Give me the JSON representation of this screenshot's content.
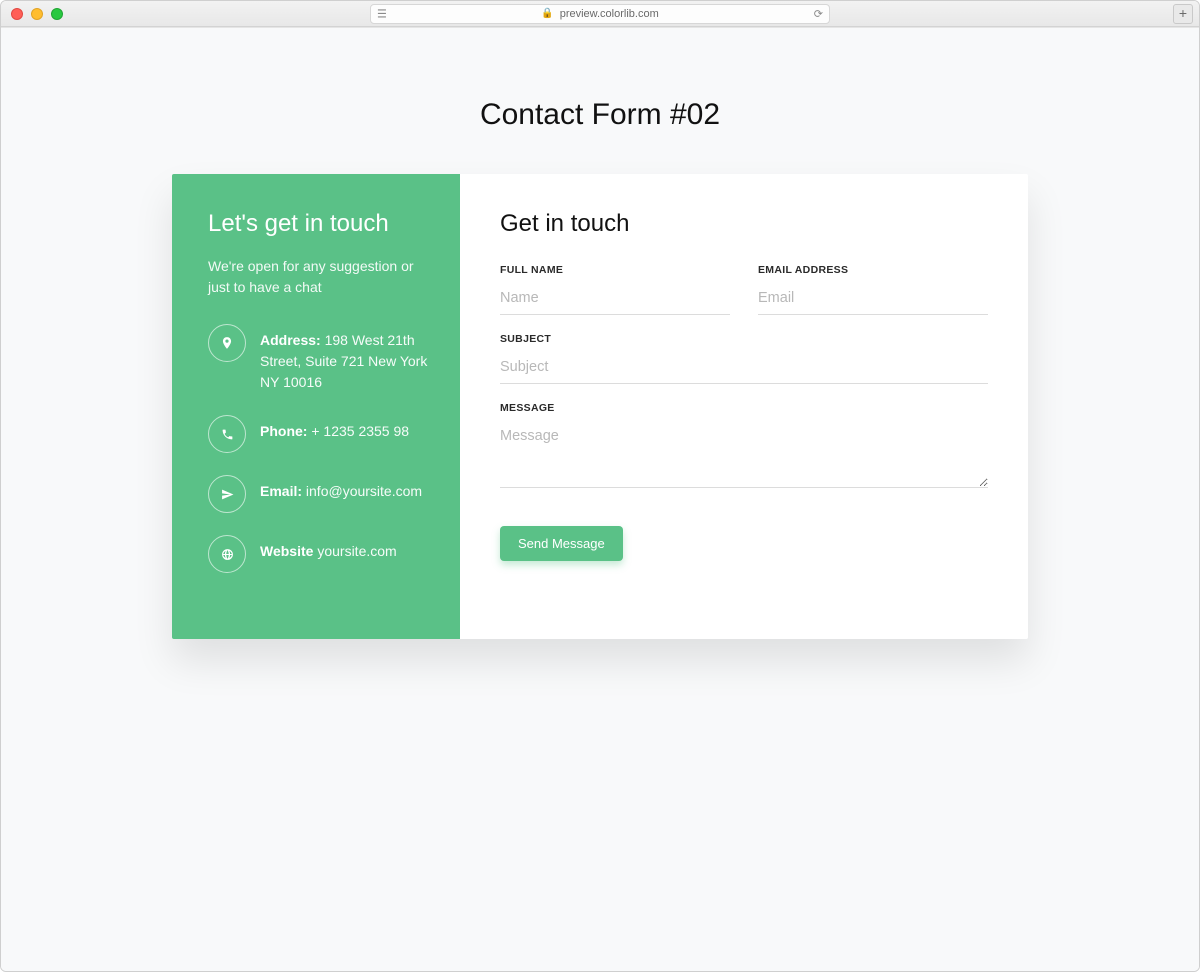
{
  "browser": {
    "url_host": "preview.colorlib.com"
  },
  "page": {
    "title": "Contact Form #02"
  },
  "left": {
    "heading": "Let's get in touch",
    "subtext": "We're open for any suggestion or just to have a chat",
    "address_label": "Address:",
    "address_value": "198 West 21th Street, Suite 721 New York NY 10016",
    "phone_label": "Phone:",
    "phone_value": "+ 1235 2355 98",
    "email_label": "Email:",
    "email_value": "info@yoursite.com",
    "website_label": "Website",
    "website_value": "yoursite.com"
  },
  "form": {
    "heading": "Get in touch",
    "fullname_label": "FULL NAME",
    "fullname_placeholder": "Name",
    "email_label": "EMAIL ADDRESS",
    "email_placeholder": "Email",
    "subject_label": "SUBJECT",
    "subject_placeholder": "Subject",
    "message_label": "MESSAGE",
    "message_placeholder": "Message",
    "submit_label": "Send Message"
  }
}
